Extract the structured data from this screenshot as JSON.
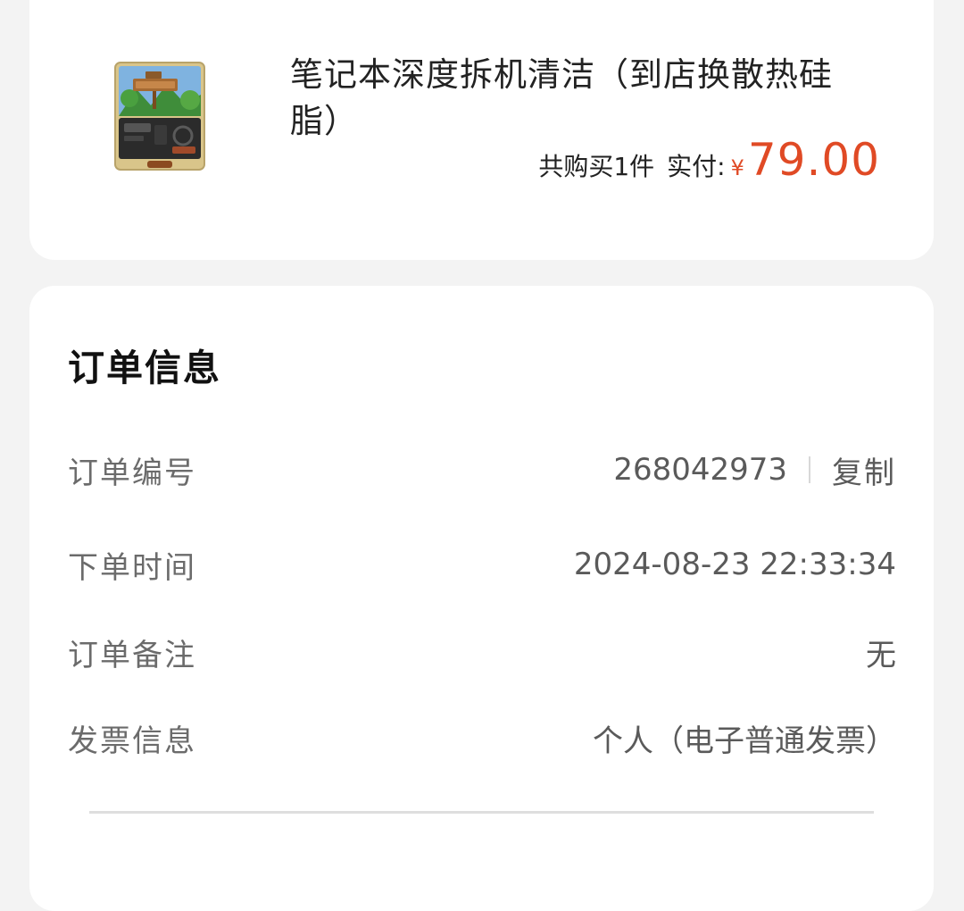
{
  "product": {
    "title": "笔记本深度拆机清洁（到店换散热硅脂）",
    "image_alt": "笔记本深度拆机清洁",
    "quantity_text": "共购买1件",
    "paid_label": "实付:",
    "currency": "¥",
    "amount": "79.00"
  },
  "order_info": {
    "title": "订单信息",
    "rows": [
      {
        "label": "订单编号",
        "value": "268042973",
        "action": "复制"
      },
      {
        "label": "下单时间",
        "value": "2024-08-23 22:33:34"
      },
      {
        "label": "订单备注",
        "value": "无"
      },
      {
        "label": "发票信息",
        "value": "个人（电子普通发票）"
      }
    ]
  },
  "colors": {
    "price": "#e04a25",
    "background": "#f3f3f3",
    "card": "#ffffff"
  }
}
